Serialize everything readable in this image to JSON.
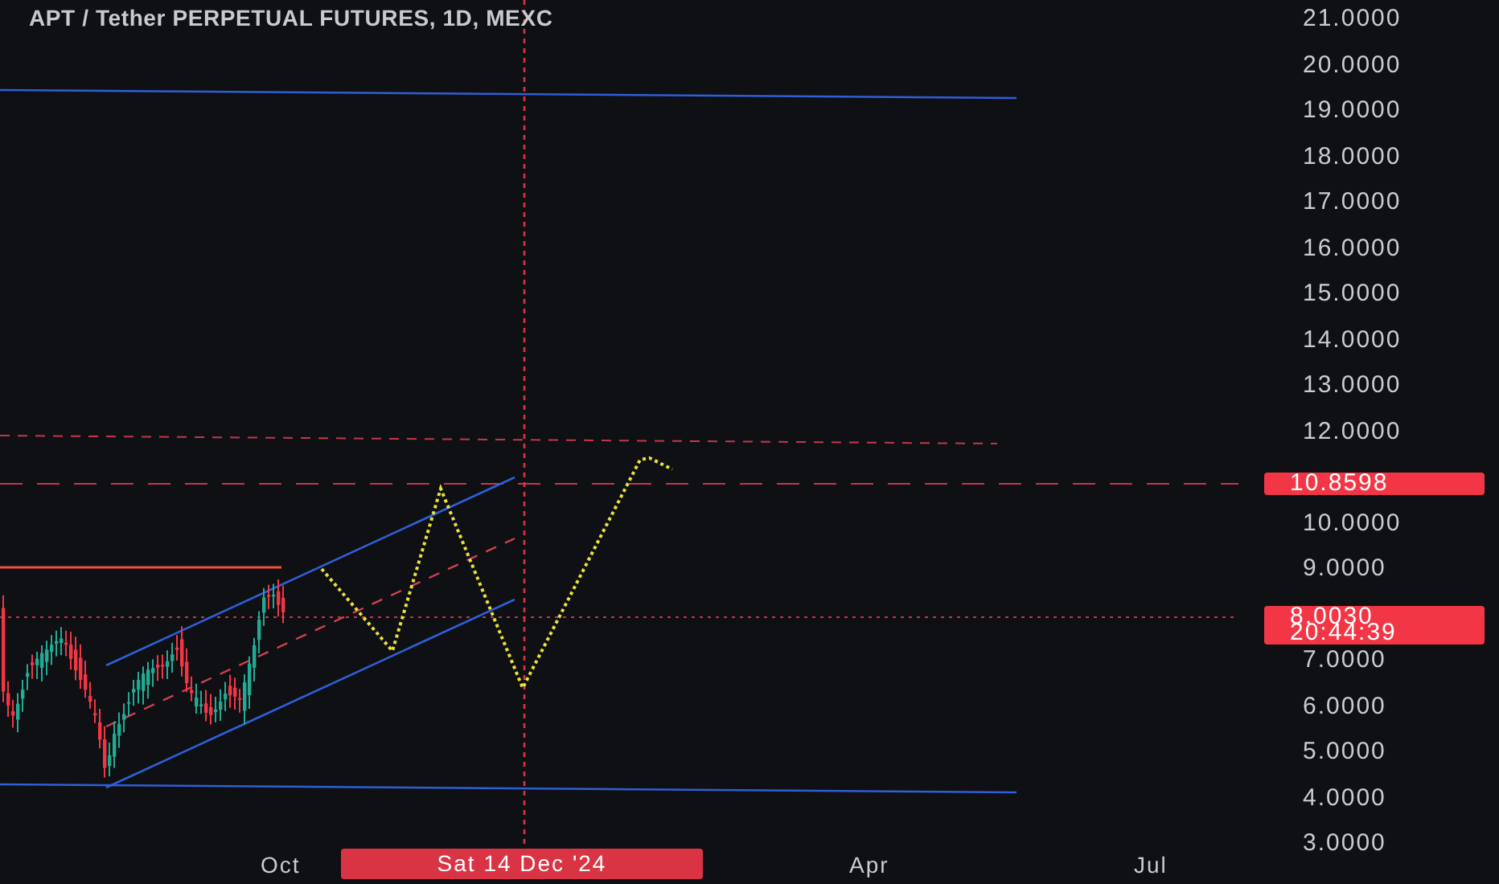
{
  "title": "APT / Tether PERPETUAL FUTURES, 1D, MEXC",
  "price_axis": {
    "upper_labels": [
      "21.0000",
      "20.0000",
      "19.0000",
      "18.0000",
      "17.0000",
      "16.0000",
      "15.0000",
      "14.0000",
      "13.0000",
      "12.0000"
    ],
    "middle_labels": [
      "10.0000",
      "9.0000"
    ],
    "lower_labels": [
      "7.0000",
      "6.0000",
      "5.0000",
      "4.0000",
      "3.0000"
    ]
  },
  "price_badges": [
    {
      "kind": "level",
      "value": "10.8598"
    },
    {
      "kind": "last",
      "value": "8.0030",
      "countdown": "20:44:39"
    }
  ],
  "time_axis": {
    "labels": [
      "Oct",
      "Apr",
      "Jul"
    ],
    "crosshair_date": "Sat 14 Dec '24"
  }
}
